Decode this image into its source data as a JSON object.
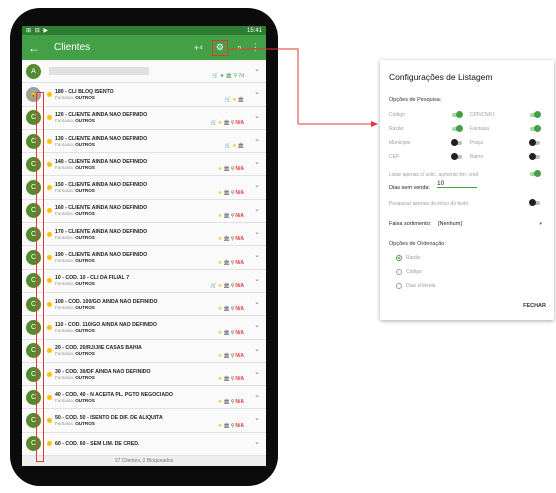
{
  "statusbar": {
    "icons": "⊞ ⊟ ▶",
    "time": "15:41"
  },
  "appbar": {
    "title": "Clientes",
    "back_icon": "←",
    "add_icon": "+⁴",
    "filter_icon": "⚙",
    "search_icon": "⌕",
    "menu_icon": "⋮"
  },
  "first_row": {
    "avatar": "A",
    "icons": "🛒 ★ 🏛 ⚲ 7d"
  },
  "rows": [
    {
      "avatar": "lock",
      "name": "180 - CLI BLOQ ISENTO",
      "fantasia_label": "Fantasia:",
      "fantasia": "OUTROS",
      "icons": "cart"
    },
    {
      "avatar": "C",
      "name": "120 - CLIENTE AINDA NÃO DEFINIDO",
      "fantasia_label": "Fantasia:",
      "fantasia": "OUTROS",
      "icons": "cartna"
    },
    {
      "avatar": "C",
      "name": "130 - CLIENTE AINDA NÃO DEFINIDO",
      "fantasia_label": "Fantasia:",
      "fantasia": "OUTROS",
      "icons": "cart"
    },
    {
      "avatar": "C",
      "name": "140 - CLIENTE AINDA NÃO DEFINIDO",
      "fantasia_label": "Fantasia:",
      "fantasia": "OUTROS",
      "icons": "na"
    },
    {
      "avatar": "C",
      "name": "150 - CLIENTE AINDA NÃO DEFINIDO",
      "fantasia_label": "Fantasia:",
      "fantasia": "OUTROS",
      "icons": "na"
    },
    {
      "avatar": "C",
      "name": "160 - CLIENTE AINDA NÃO DEFINIDO",
      "fantasia_label": "Fantasia:",
      "fantasia": "OUTROS",
      "icons": "na"
    },
    {
      "avatar": "C",
      "name": "170 - CLIENTE AINDA NÃO DEFINIDO",
      "fantasia_label": "Fantasia:",
      "fantasia": "OUTROS",
      "icons": "na"
    },
    {
      "avatar": "C",
      "name": "190 - CLIENTE AINDA NÃO DEFINIDO",
      "fantasia_label": "Fantasia:",
      "fantasia": "OUTROS",
      "icons": "na"
    },
    {
      "avatar": "C",
      "name": "10 - COD. 10 - CLI DA FILIAL 7",
      "fantasia_label": "Fantasia:",
      "fantasia": "OUTROS",
      "icons": "cartna"
    },
    {
      "avatar": "C",
      "name": "100 - COD. 100/GO AINDA NAO DEFINIDO",
      "fantasia_label": "Fantasia:",
      "fantasia": "OUTROS",
      "icons": "na"
    },
    {
      "avatar": "C",
      "name": "110 - COD. 110/GO AINDA NAO DEFINIDO",
      "fantasia_label": "Fantasia:",
      "fantasia": "OUTROS",
      "icons": "na"
    },
    {
      "avatar": "C",
      "name": "20 - COD. 20/RJ/J/IE CASAS BAHIA",
      "fantasia_label": "Fantasia:",
      "fantasia": "OUTROS",
      "icons": "na"
    },
    {
      "avatar": "C",
      "name": "30 - COD. 30/DF AINDA NAO DEFINIDO",
      "fantasia_label": "Fantasia:",
      "fantasia": "OUTROS",
      "icons": "na"
    },
    {
      "avatar": "C",
      "name": "40 - COD. 40 - N ACEITA PL. PGTO NEGOCIADO",
      "fantasia_label": "Fantasia:",
      "fantasia": "OUTROS",
      "icons": "na"
    },
    {
      "avatar": "C",
      "name": "50 - COD. 50 - ISENTO DE DIF. DE ALIQUITA",
      "fantasia_label": "Fantasia:",
      "fantasia": "OUTROS",
      "icons": "na"
    },
    {
      "avatar": "C",
      "name": "60 - COD. 60 - SEM LIM. DE CRED.",
      "fantasia_label": "",
      "fantasia": "",
      "icons": "none"
    }
  ],
  "row_icons": {
    "cart": "🛒",
    "star": "★",
    "bank": "🏛",
    "pin": "⚲",
    "na": "N/A",
    "chevron": "⌄"
  },
  "footer": "27 Clientes, 2 Bloqueados",
  "dialog": {
    "title": "Configurações de Listagem",
    "search_section": "Opções de Pesquisa:",
    "options": [
      {
        "label": "Código",
        "on": true
      },
      {
        "label": "CPF/CNPJ",
        "on": true
      },
      {
        "label": "Razão",
        "on": true
      },
      {
        "label": "Fantasia",
        "on": true
      },
      {
        "label": "Município",
        "on": false
      },
      {
        "label": "Praça",
        "on": false
      },
      {
        "label": "CEP",
        "on": false
      },
      {
        "label": "Bairro",
        "on": false
      }
    ],
    "list_only_label": "Listar apenas c/ solic. aumento lim. cred",
    "dias_label": "Dias sem venda:",
    "dias_value": "10",
    "pesquisar_label": "Pesquisar apenas do início do texto",
    "faixa_label": "Faixa sortimento:",
    "faixa_value": "[Nenhum]",
    "order_section": "Opções de Ordenação:",
    "order_options": [
      {
        "label": "Razão",
        "selected": true
      },
      {
        "label": "Código",
        "selected": false
      },
      {
        "label": "Dias s/Venda",
        "selected": false
      }
    ],
    "close_label": "FECHAR"
  },
  "colors": {
    "primary": "#43a047",
    "annotation": "#e53935",
    "star": "#ffc107"
  }
}
